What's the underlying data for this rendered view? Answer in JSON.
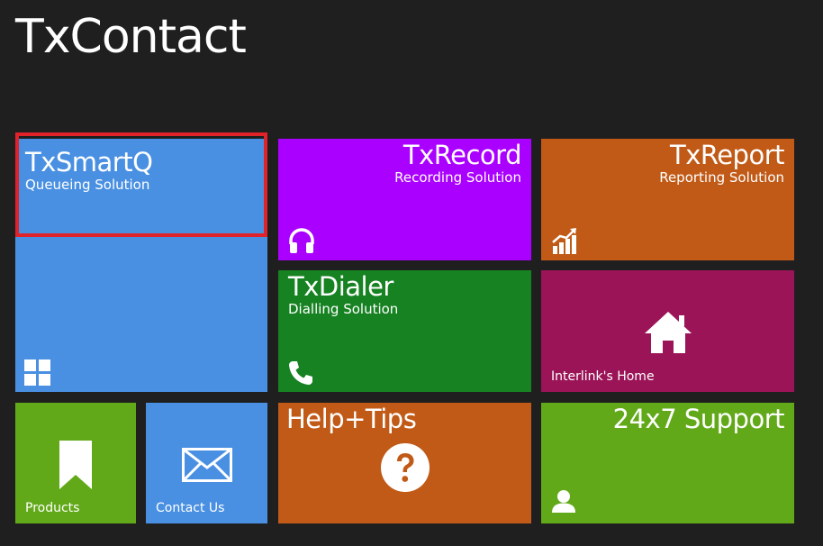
{
  "app": {
    "title": "TxContact"
  },
  "tiles": {
    "smartq": {
      "title": "TxSmartQ",
      "subtitle": "Queueing Solution",
      "icon": "windows-grid-icon",
      "color": "#4a90e2"
    },
    "record": {
      "title": "TxRecord",
      "subtitle": "Recording Solution",
      "icon": "headphones-icon",
      "color": "#aa00ff"
    },
    "report": {
      "title": "TxReport",
      "subtitle": "Reporting Solution",
      "icon": "bar-chart-icon",
      "color": "#c15a17"
    },
    "dialer": {
      "title": "TxDialer",
      "subtitle": "Dialling Solution",
      "icon": "phone-icon",
      "color": "#178222"
    },
    "home": {
      "label": "Interlink's Home",
      "icon": "home-icon",
      "color": "#9b1458"
    },
    "products": {
      "label": "Products",
      "icon": "bookmark-icon",
      "color": "#62a919"
    },
    "contact": {
      "label": "Contact Us",
      "icon": "envelope-icon",
      "color": "#4a90e2"
    },
    "help": {
      "title": "Help+Tips",
      "icon": "question-icon",
      "color": "#c15a17"
    },
    "support": {
      "title": "24x7 Support",
      "icon": "user-icon",
      "color": "#62a919"
    }
  },
  "focus": {
    "tile": "smartq",
    "color": "#e0232a"
  }
}
